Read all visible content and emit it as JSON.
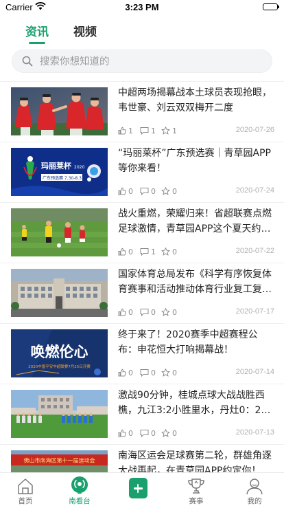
{
  "status_bar": {
    "carrier": "Carrier",
    "time": "3:23 PM"
  },
  "tabs": [
    {
      "label": "资讯",
      "active": true
    },
    {
      "label": "视频",
      "active": false
    }
  ],
  "search": {
    "placeholder": "搜索你想知道的"
  },
  "news": [
    {
      "title": "中超两场揭幕战本土球员表现抢眼，韦世豪、刘云双双梅开二度",
      "likes": "1",
      "comments": "1",
      "favorites": "1",
      "date": "2020-07-26",
      "thumb": "football-players-red-jerseys"
    },
    {
      "title": "“玛丽莱杯”广东预选赛｜青草园APP等你来看！",
      "likes": "0",
      "comments": "0",
      "favorites": "0",
      "date": "2020-07-24",
      "thumb": "tournament-poster-blue"
    },
    {
      "title": "战火重燃，荣耀归来！省超联赛点燃足球激情，青草园APP这个夏天约…",
      "likes": "0",
      "comments": "1",
      "favorites": "0",
      "date": "2020-07-22",
      "thumb": "match-on-pitch"
    },
    {
      "title": "国家体育总局发布《科学有序恢复体育赛事和活动推动体育行业复工复…",
      "likes": "0",
      "comments": "0",
      "favorites": "0",
      "date": "2020-07-17",
      "thumb": "government-building"
    },
    {
      "title": "终于来了！2020赛季中超赛程公布：申花恒大打响揭幕战！",
      "likes": "0",
      "comments": "0",
      "favorites": "0",
      "date": "2020-07-14",
      "thumb": "csl-poster",
      "thumb_text": "唤燃伦心",
      "thumb_caption": "2020中国平安中超联赛7月25日开赛"
    },
    {
      "title": "激战90分钟，桂城点球大战战胜西樵，九江3:2小胜里水，丹灶0：2…",
      "likes": "0",
      "comments": "0",
      "favorites": "0",
      "date": "2020-07-13",
      "thumb": "team-lineup-field"
    },
    {
      "title": "南海区运会足球赛第二轮，群雄角逐大战再起，在青草园APP约定你！",
      "likes": "0",
      "comments": "0",
      "favorites": "0",
      "date": "",
      "thumb": "district-games-banner"
    }
  ],
  "thumb_texts": {
    "poster_brand": "玛丽莱杯",
    "poster_year": "2020",
    "poster_region": "广东预选赛 7.30-8.3",
    "banner_text": "佛山市南海区第十一届运动会"
  },
  "bottom_nav": [
    {
      "label": "首页",
      "icon": "home-icon",
      "active": false
    },
    {
      "label": "南看台",
      "icon": "live-broadcast-icon",
      "active": true
    },
    {
      "label": "",
      "icon": "add-icon",
      "active": false
    },
    {
      "label": "赛事",
      "icon": "trophy-icon",
      "active": false
    },
    {
      "label": "我的",
      "icon": "user-icon",
      "active": false
    }
  ],
  "colors": {
    "accent": "#1aa06d",
    "text": "#222222",
    "meta": "#8c8c8c"
  }
}
